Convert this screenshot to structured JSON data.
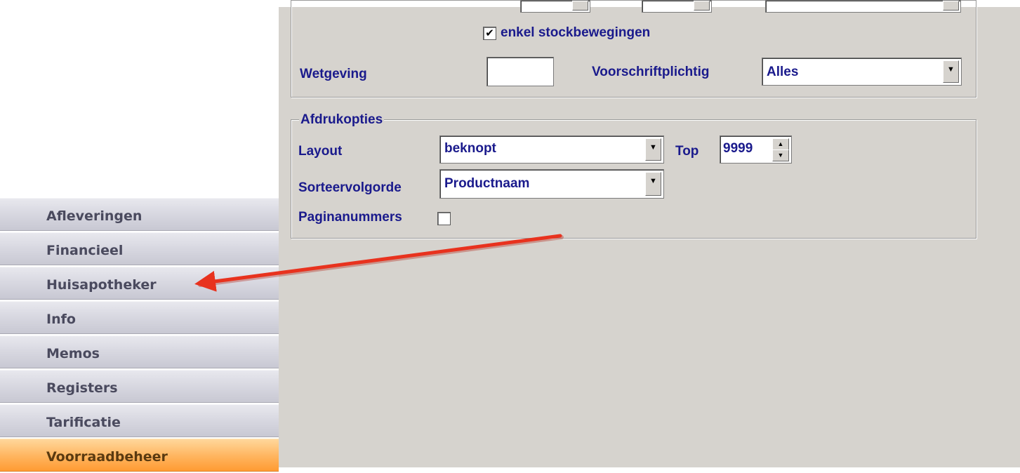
{
  "filter": {
    "enkel_stock_label": "enkel stockbewegingen",
    "enkel_stock_checked": true,
    "wetgeving_label": "Wetgeving",
    "wetgeving_value": "",
    "voorschrift_label": "Voorschriftplichtig",
    "voorschrift_value": "Alles"
  },
  "afdruk": {
    "legend": "Afdrukopties",
    "layout_label": "Layout",
    "layout_value": "beknopt",
    "top_label": "Top",
    "top_value": "9999",
    "sort_label": "Sorteervolgorde",
    "sort_value": "Productnaam",
    "pagina_label": "Paginanummers",
    "pagina_checked": false
  },
  "sidebar": {
    "items": [
      {
        "label": "Afleveringen"
      },
      {
        "label": "Financieel"
      },
      {
        "label": "Huisapotheker"
      },
      {
        "label": "Info"
      },
      {
        "label": "Memos"
      },
      {
        "label": "Registers"
      },
      {
        "label": "Tarificatie"
      },
      {
        "label": "Voorraadbeheer"
      }
    ],
    "active_index": 7
  },
  "icons": {
    "dropdown": "chevron-down-icon",
    "spinner": "spinner-arrows-icon",
    "annotation": "red-arrow-annotation"
  },
  "colors": {
    "label_text": "#1a1a8c",
    "panel_bg": "#d6d3ce",
    "active_tab": "#ffb45d",
    "annotation": "#e8321e"
  }
}
